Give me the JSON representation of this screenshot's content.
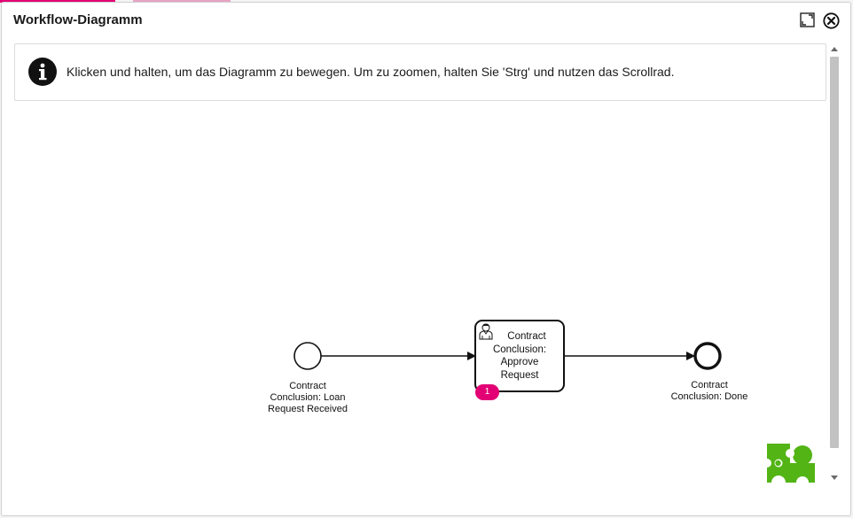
{
  "dialog": {
    "title": "Workflow-Diagramm",
    "maximize_icon": "maximize-icon",
    "close_icon": "close-circle-icon"
  },
  "info": {
    "icon": "info-icon",
    "text": "Klicken und halten, um das Diagramm zu bewegen. Um zu zoomen, halten Sie 'Strg' und nutzen das Scrollrad."
  },
  "diagram": {
    "start_event": {
      "label_line1": "Contract",
      "label_line2": "Conclusion: Loan",
      "label_line3": "Request Received"
    },
    "user_task": {
      "icon": "user-icon",
      "label_line1": "Contract",
      "label_line2": "Conclusion:",
      "label_line3": "Approve",
      "label_line4": "Request",
      "badge_count": "1"
    },
    "end_event": {
      "label_line1": "Contract",
      "label_line2": "Conclusion: Done"
    }
  },
  "logo": {
    "icon": "bpmn-puzzle-logo",
    "color": "#52b415"
  },
  "colors": {
    "accent": "#e20074",
    "logo_green": "#52b415"
  }
}
